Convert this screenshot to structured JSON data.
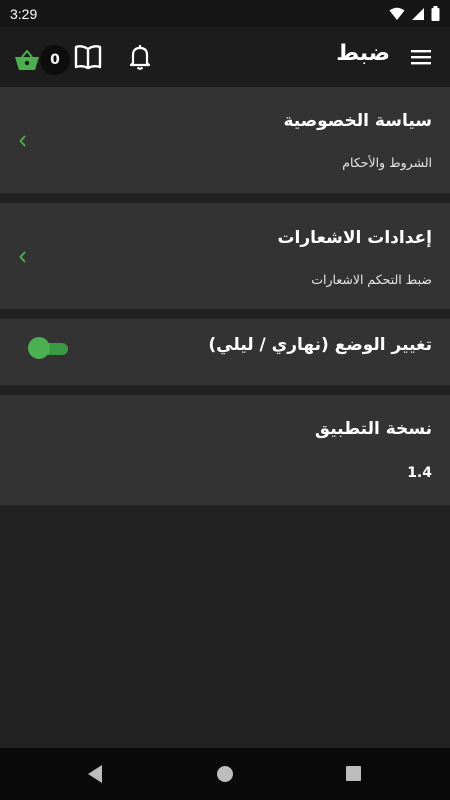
{
  "status_bar": {
    "time": "3:29",
    "icons": [
      "wifi-icon",
      "cellular-icon",
      "battery-icon"
    ]
  },
  "app_bar": {
    "title": "ضبط",
    "cart_count": "0",
    "icons": [
      "menu-icon",
      "bell-icon",
      "book-icon",
      "cart-icon"
    ]
  },
  "items": [
    {
      "title": "سياسة الخصوصية",
      "subtitle": "الشروط والأحكام"
    },
    {
      "title": "إعدادات الاشعارات",
      "subtitle": "ضبط التحكم الاشعارات"
    },
    {
      "title": "تغيير الوضع (نهاري / ليلي)",
      "toggle_on": true
    },
    {
      "title": "نسخة التطبيق",
      "value": "1.4"
    }
  ],
  "colors": {
    "accent": "#4caf50",
    "background": "#222222",
    "card": "#333333",
    "app_bar": "#1c1c1c"
  }
}
